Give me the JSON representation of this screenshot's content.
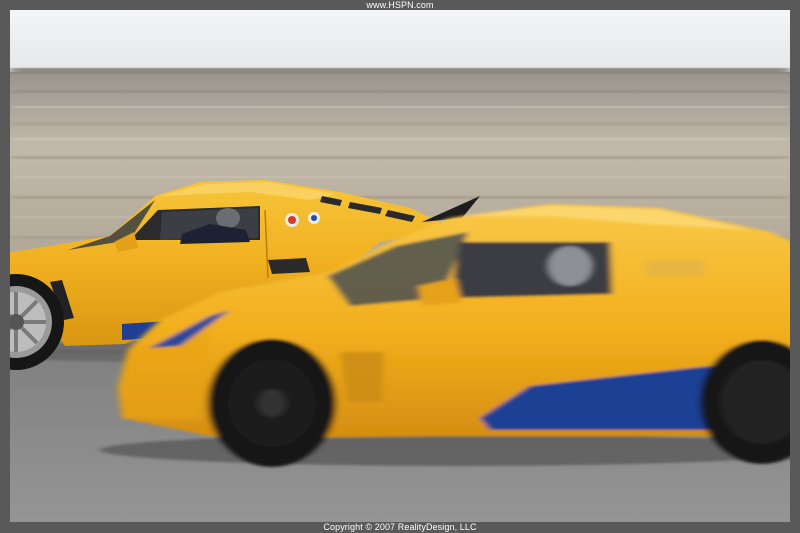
{
  "watermark_top": "www.HSPN.com",
  "copyright_bottom": "Copyright © 2007 RealityDesign, LLC",
  "colors": {
    "frame": "#595959",
    "sky": "#f1f3f4",
    "car_yellow": "#f2b21e",
    "car_blue": "#1f3f94",
    "tarmac": "#8d8d8d",
    "field": "#b7ada0"
  },
  "scene": {
    "subjects": [
      "yellow-sports-car-rear",
      "yellow-sports-car-front"
    ]
  }
}
